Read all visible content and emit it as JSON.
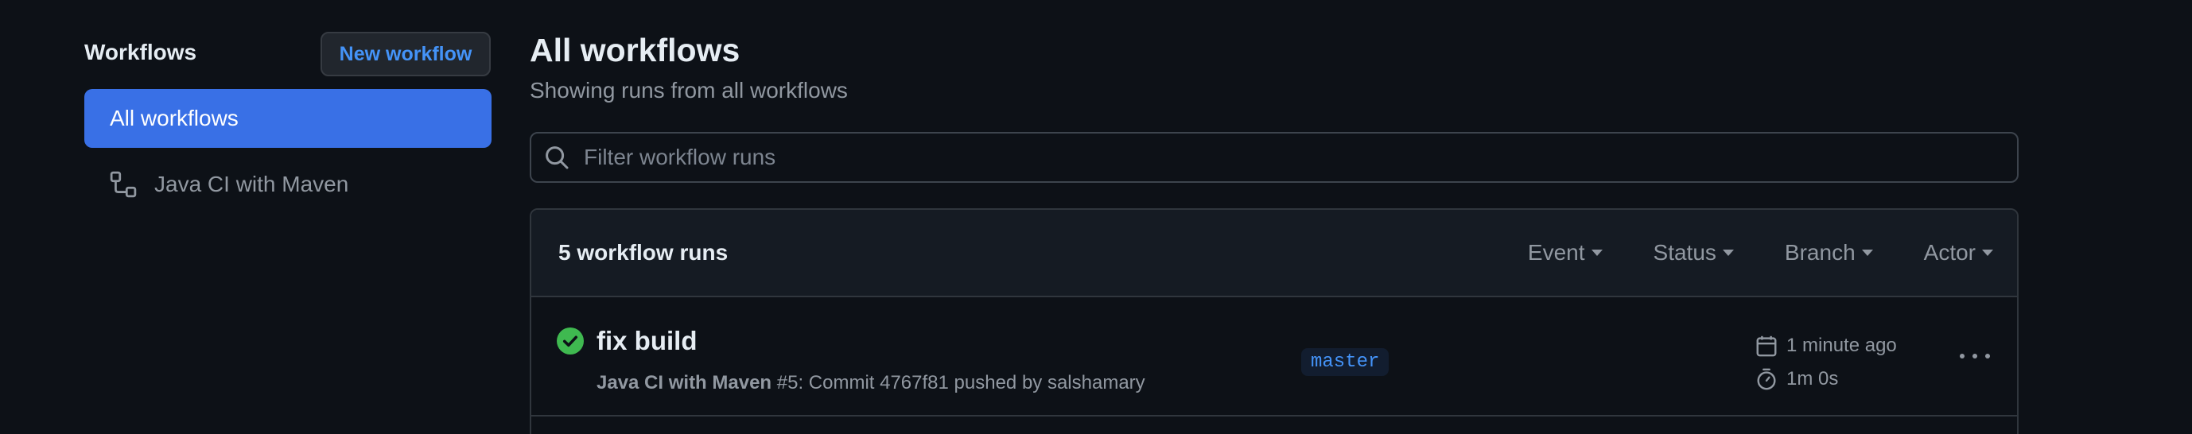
{
  "sidebar": {
    "title": "Workflows",
    "new_workflow_label": "New workflow",
    "items": [
      {
        "label": "All workflows",
        "active": true
      },
      {
        "label": "Java CI with Maven",
        "icon": "workflow-icon"
      }
    ]
  },
  "main": {
    "title": "All workflows",
    "subtitle": "Showing runs from all workflows",
    "filter_placeholder": "Filter workflow runs",
    "filter_value": ""
  },
  "runs": {
    "count_label": "5 workflow runs",
    "filters": [
      "Event",
      "Status",
      "Branch",
      "Actor"
    ],
    "items": [
      {
        "status": "success",
        "title": "fix build",
        "workflow": "Java CI with Maven",
        "meta": " #5: Commit 4767f81 pushed by salshamary",
        "branch": "master",
        "time_ago": "1 minute ago",
        "duration": "1m 0s"
      }
    ]
  },
  "colors": {
    "background": "#0d1117",
    "accent": "#3970e6",
    "link": "#4493f8",
    "success": "#3fb950"
  }
}
